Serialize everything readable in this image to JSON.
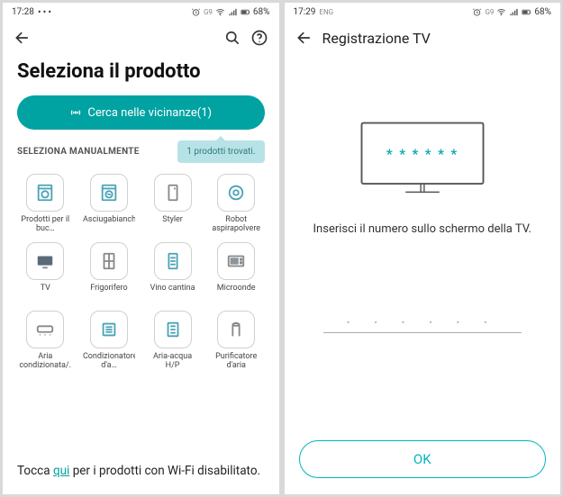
{
  "left": {
    "status": {
      "time": "17:28",
      "dots": "•••",
      "battery": "68%"
    },
    "title": "Seleziona il prodotto",
    "scan_button": "Cerca nelle vicinanze(1)",
    "section_label": "SELEZIONA MANUALMENTE",
    "found_bubble": "1 prodotti trovati.",
    "products": [
      {
        "label": "Prodotti per il buc…"
      },
      {
        "label": "Asciugabiancheria"
      },
      {
        "label": "Styler"
      },
      {
        "label": "Robot aspirapolvere"
      },
      {
        "label": "TV"
      },
      {
        "label": "Frigorifero"
      },
      {
        "label": "Vino cantina"
      },
      {
        "label": "Microonde"
      },
      {
        "label": "Aria condizionata/…"
      },
      {
        "label": "Condizionatore d'a…"
      },
      {
        "label": "Aria-acqua H/P"
      },
      {
        "label": "Purificatore d'aria"
      }
    ],
    "help_pre": "Tocca ",
    "help_link": "qui",
    "help_post": " per i prodotti con Wi-Fi disabilitato."
  },
  "right": {
    "status": {
      "time": "17:29",
      "lang": "ENG",
      "battery": "68%"
    },
    "appbar_title": "Registrazione TV",
    "tv_placeholder": "* * * * * *",
    "prompt": "Inserisci il numero sullo schermo della TV.",
    "code_dots": "• • • • • •",
    "ok": "OK"
  },
  "colors": {
    "accent": "#00a2a2"
  }
}
